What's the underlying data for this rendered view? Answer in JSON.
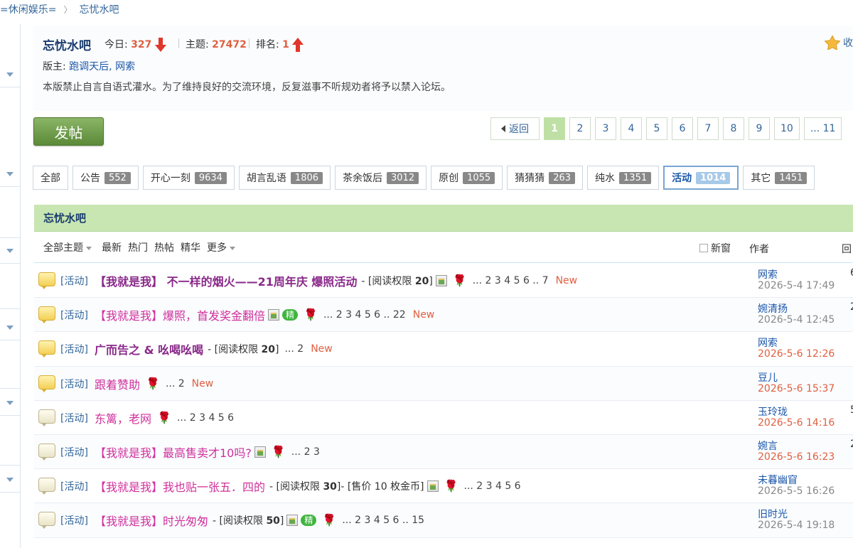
{
  "breadcrumb": {
    "parent": "=休闲娱乐=",
    "current": "忘忧水吧"
  },
  "header": {
    "forum_name": "忘忧水吧",
    "today_label": "今日:",
    "today_value": "327",
    "topics_label": "主题:",
    "topics_value": "27472",
    "rank_label": "排名:",
    "rank_value": "1",
    "moderators_label": "版主:",
    "moderators": "跑调天后, 网索",
    "notice": "本版禁止自言自语式灌水。为了维持良好的交流环境，反复滋事不听规劝者将予以禁入论坛。",
    "favorite_label": "收"
  },
  "post_button": "发帖",
  "pager": {
    "back": "返回",
    "pages": [
      "1",
      "2",
      "3",
      "4",
      "5",
      "6",
      "7",
      "8",
      "9",
      "10",
      "... 11"
    ],
    "current": "1"
  },
  "categories": [
    {
      "label": "全部",
      "count": ""
    },
    {
      "label": "公告",
      "count": "552"
    },
    {
      "label": "开心一刻",
      "count": "9634"
    },
    {
      "label": "胡言乱语",
      "count": "1806"
    },
    {
      "label": "茶余饭后",
      "count": "3012"
    },
    {
      "label": "原创",
      "count": "1055"
    },
    {
      "label": "猜猜猜",
      "count": "263"
    },
    {
      "label": "纯水",
      "count": "1351"
    },
    {
      "label": "活动",
      "count": "1014",
      "active": true
    },
    {
      "label": "其它",
      "count": "1451"
    }
  ],
  "list_title": "忘忧水吧",
  "filters": {
    "all_topics": "全部主题",
    "latest": "最新",
    "hot": "热门",
    "hot_posts": "热帖",
    "digest": "精华",
    "more": "更多",
    "new_window": "新窗",
    "author_col": "作者",
    "reply_col": "回"
  },
  "threads": [
    {
      "type": "[活动]",
      "title": "【我就是我】 不一样的烟火——21周年庆 爆照活动",
      "style": "bold",
      "extra_pre": "- [阅读权限 ",
      "extra_bold": "20",
      "extra_post": "]",
      "img": true,
      "jing": false,
      "rose": true,
      "pages": "... 2 3 4 5 6 .. 7",
      "new": "New",
      "author": "网索",
      "date": "2026-5-4 17:49",
      "date_hot": false,
      "replies": "6",
      "icon": "new"
    },
    {
      "type": "[活动]",
      "title": "【我就是我】爆照，首发奖金翻倍",
      "style": "pink",
      "extra_pre": "",
      "extra_bold": "",
      "extra_post": "",
      "img": true,
      "jing": true,
      "jing_label": "精",
      "rose": true,
      "pages": "... 2 3 4 5 6 .. 22",
      "new": "New",
      "author": "婉清扬",
      "date": "2026-5-4 12:45",
      "date_hot": false,
      "replies": "2",
      "icon": "new"
    },
    {
      "type": "[活动]",
      "title": "广而告之 & 吆喝吆喝",
      "style": "bold",
      "extra_pre": "- [阅读权限 ",
      "extra_bold": "20",
      "extra_post": "]",
      "img": false,
      "jing": false,
      "rose": false,
      "pages": "... 2",
      "new": "New",
      "author": "网索",
      "date": "2026-5-6 12:26",
      "date_hot": true,
      "replies": "",
      "icon": "new"
    },
    {
      "type": "[活动]",
      "title": "跟着赞助",
      "style": "pink",
      "extra_pre": "",
      "extra_bold": "",
      "extra_post": "",
      "img": false,
      "jing": false,
      "rose": true,
      "pages": "... 2",
      "new": "New",
      "author": "豆儿",
      "date": "2026-5-6 15:37",
      "date_hot": true,
      "replies": "",
      "icon": "new"
    },
    {
      "type": "[活动]",
      "title": "东篱，老网",
      "style": "pink",
      "extra_pre": "",
      "extra_bold": "",
      "extra_post": "",
      "img": false,
      "jing": false,
      "rose": true,
      "pages": "... 2 3 4 5 6",
      "new": "",
      "author": "玉玲珑",
      "date": "2026-5-6 14:16",
      "date_hot": true,
      "replies": "5",
      "icon": "old"
    },
    {
      "type": "[活动]",
      "title": "【我就是我】最高售卖才10吗?",
      "style": "pink",
      "extra_pre": "",
      "extra_bold": "",
      "extra_post": "",
      "img": true,
      "jing": false,
      "rose": true,
      "pages": "... 2 3",
      "new": "",
      "author": "婉言",
      "date": "2026-5-6 16:23",
      "date_hot": true,
      "replies": "2",
      "icon": "old"
    },
    {
      "type": "[活动]",
      "title": "【我就是我】我也贴一张五．四的",
      "style": "pink",
      "extra_pre": "- [阅读权限 ",
      "extra_bold": "30",
      "extra_post": "]- [售价 10 枚金币]",
      "img": true,
      "jing": false,
      "rose": true,
      "pages": "... 2 3 4 5 6",
      "new": "",
      "author": "未暮幽窅",
      "date": "2026-5-5 16:26",
      "date_hot": false,
      "replies": "",
      "icon": "old"
    },
    {
      "type": "[活动]",
      "title": "【我就是我】时光匆匆",
      "style": "pink",
      "extra_pre": "- [阅读权限 ",
      "extra_bold": "50",
      "extra_post": "]",
      "img": true,
      "jing": true,
      "jing_label": "精",
      "rose": true,
      "pages": "... 2 3 4 5 6 .. 15",
      "new": "",
      "author": "旧时光",
      "date": "2026-5-4 19:18",
      "date_hot": false,
      "replies": "",
      "icon": "old"
    }
  ]
}
